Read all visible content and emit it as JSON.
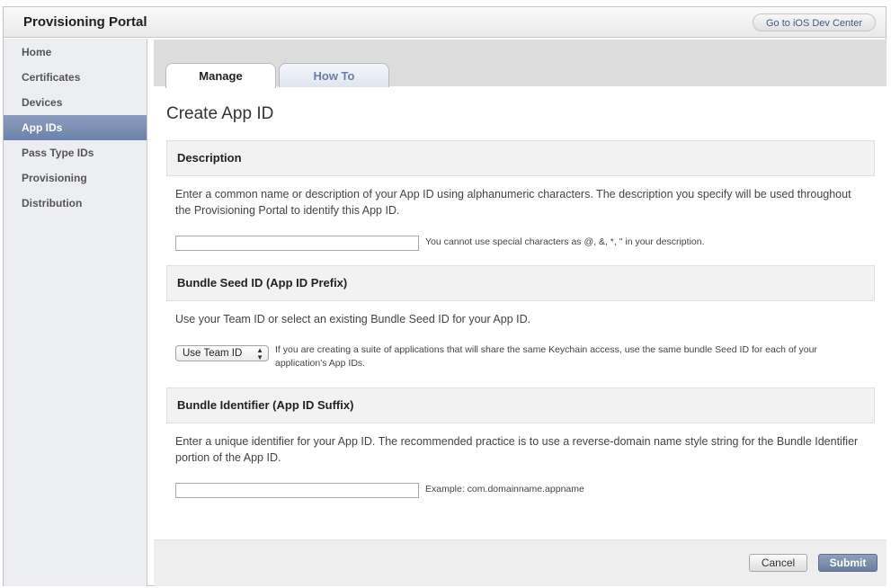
{
  "header": {
    "title": "Provisioning Portal",
    "dev_center_link": "Go to iOS Dev Center"
  },
  "sidebar": {
    "items": [
      {
        "label": "Home"
      },
      {
        "label": "Certificates"
      },
      {
        "label": "Devices"
      },
      {
        "label": "App IDs",
        "active": true
      },
      {
        "label": "Pass Type IDs"
      },
      {
        "label": "Provisioning"
      },
      {
        "label": "Distribution"
      }
    ]
  },
  "tabs": [
    {
      "label": "Manage",
      "active": true
    },
    {
      "label": "How To"
    }
  ],
  "page": {
    "title": "Create App ID"
  },
  "description_section": {
    "heading": "Description",
    "text": "Enter a common name or description of your App ID using alphanumeric characters. The description you specify will be used throughout the Provisioning Portal to identify this App ID.",
    "input_value": "",
    "hint": "You cannot use special characters as @, &, *, \" in your description."
  },
  "seed_section": {
    "heading": "Bundle Seed ID (App ID Prefix)",
    "text": "Use your Team ID or select an existing Bundle Seed ID for your App ID.",
    "select_value": "Use Team ID",
    "hint": "If you are creating a suite of applications that will share the same Keychain access, use the same bundle Seed ID for each of your application's App IDs."
  },
  "identifier_section": {
    "heading": "Bundle Identifier (App ID Suffix)",
    "text": "Enter a unique identifier for your App ID. The recommended practice is to use a reverse-domain name style string for the Bundle Identifier portion of the App ID.",
    "input_value": "",
    "hint": "Example: com.domainname.appname"
  },
  "footer": {
    "cancel_label": "Cancel",
    "submit_label": "Submit"
  },
  "colors": {
    "active_nav": "#6c82aa",
    "submit_button": "#6a7d9c",
    "link": "#3d5a86"
  }
}
